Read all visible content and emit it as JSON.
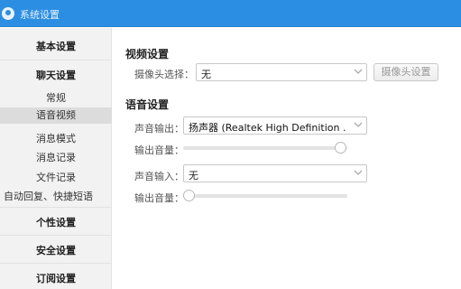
{
  "window": {
    "title": "系统设置"
  },
  "sidebar": {
    "items": [
      {
        "label": "基本设置"
      },
      {
        "label": "聊天设置"
      },
      {
        "label": "常规"
      },
      {
        "label": "语音视频"
      },
      {
        "label": "消息模式"
      },
      {
        "label": "消息记录"
      },
      {
        "label": "文件记录"
      },
      {
        "label": "自动回复、快捷短语"
      },
      {
        "label": "个性设置"
      },
      {
        "label": "安全设置"
      },
      {
        "label": "订阅设置"
      }
    ],
    "active_item": "语音视频"
  },
  "video": {
    "section_title": "视频设置",
    "camera_label": "摄像头选择：",
    "camera_value": "无",
    "camera_settings_button": "摄像头设置"
  },
  "audio": {
    "section_title": "语音设置",
    "output_label": "声音输出：",
    "output_value": "扬声器 (Realtek High Definition .",
    "output_volume_label": "输出音量：",
    "output_volume_level": 1.0,
    "input_label": "声音输入：",
    "input_value": "无",
    "input_volume_label": "输出音量：",
    "input_volume_level": 0.0
  },
  "icons": {
    "app": "app-logo-icon",
    "dropdown": "chevron-down-icon"
  },
  "colors": {
    "titlebar": "#2c8ee3",
    "sidebar_bg": "#f2f2f2",
    "active_item_bg": "#dcdcdc"
  }
}
